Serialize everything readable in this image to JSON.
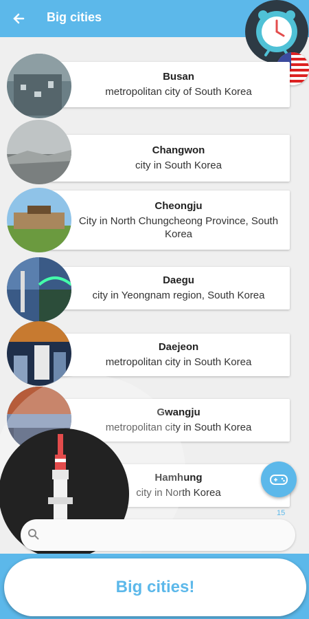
{
  "appbar": {
    "title": "Big cities"
  },
  "cities": [
    {
      "name": "Busan",
      "desc": "metropolitan city of South Korea",
      "img": "busan-photo"
    },
    {
      "name": "Changwon",
      "desc": "city in South Korea",
      "img": "changwon-photo"
    },
    {
      "name": "Cheongju",
      "desc": "City in North Chungcheong Province, South Korea",
      "img": "cheongju-photo"
    },
    {
      "name": "Daegu",
      "desc": "city in Yeongnam region, South Korea",
      "img": "daegu-photo"
    },
    {
      "name": "Daejeon",
      "desc": "metropolitan city in South Korea",
      "img": "daejeon-photo"
    },
    {
      "name": "Gwangju",
      "desc": "metropolitan city in South Korea",
      "img": "gwangju-photo"
    },
    {
      "name": "Hamhung",
      "desc": "city in North Korea",
      "img": "hamhung-photo"
    }
  ],
  "list_count": "15",
  "bottom_button": {
    "label": "Big cities!"
  },
  "colors": {
    "accent": "#5cb8ea",
    "clock_bg": "#2d3a44"
  },
  "icons": {
    "back": "back-arrow-icon",
    "clock": "alarm-clock-icon",
    "flag": "us-flag-icon",
    "game": "gamepad-icon",
    "search": "search-icon"
  }
}
